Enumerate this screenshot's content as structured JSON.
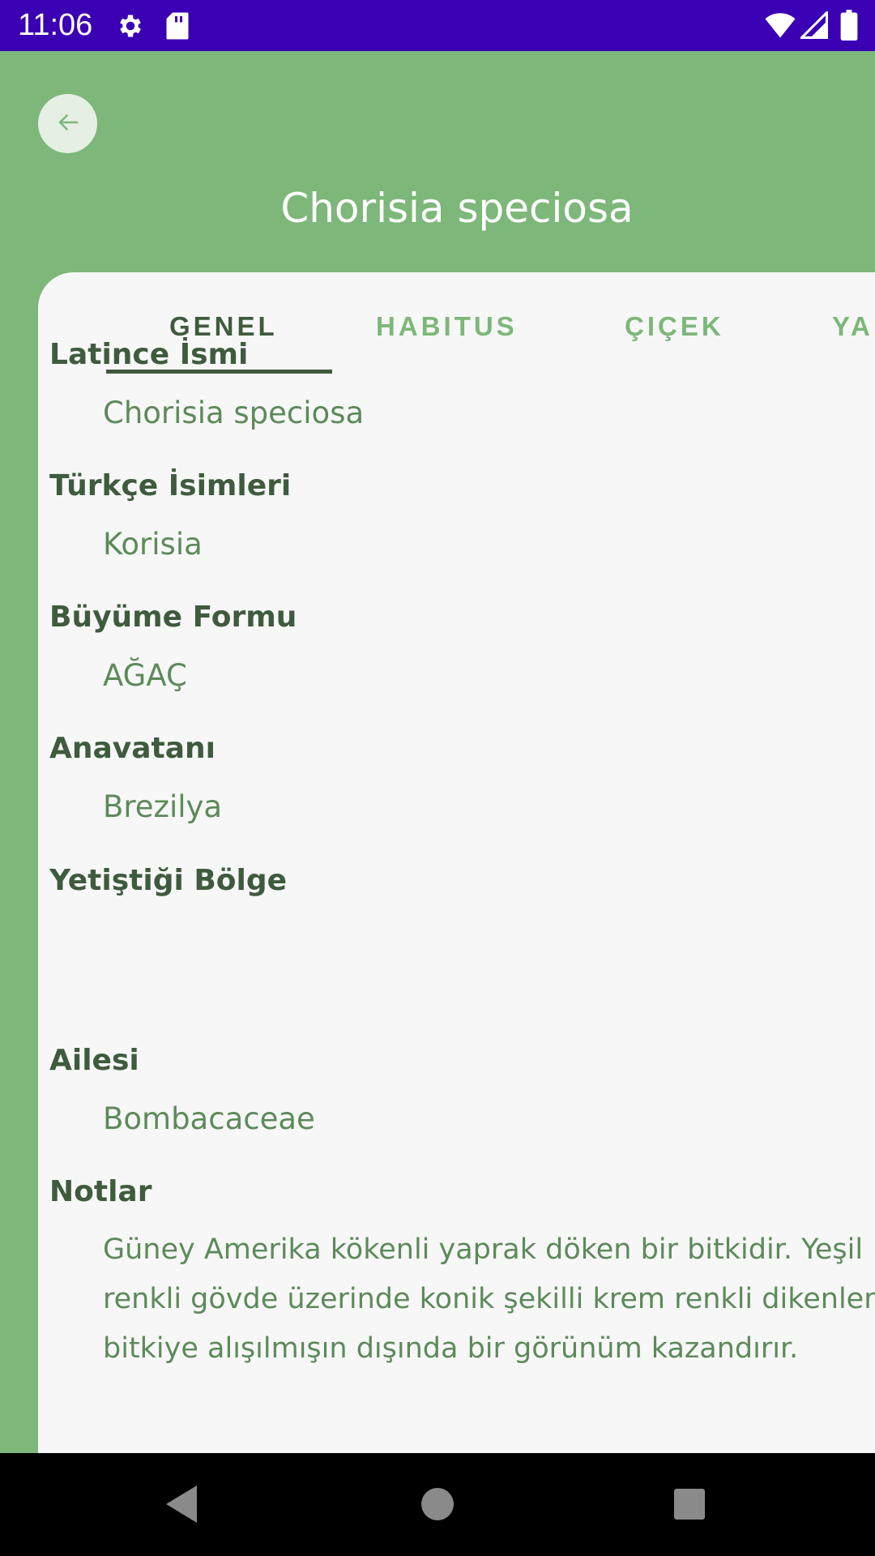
{
  "status_bar": {
    "time": "11:06",
    "icons": [
      "gear-icon",
      "sd-card-icon",
      "wifi-icon",
      "signal-icon",
      "battery-icon"
    ],
    "color": "#3b00b3"
  },
  "header": {
    "back_icon": "arrow-left-icon",
    "title": "Chorisia speciosa",
    "color": "#7db77a"
  },
  "tabs": [
    {
      "label": "GENEL",
      "active": true
    },
    {
      "label": "HABITUS",
      "active": false
    },
    {
      "label": "ÇIÇEK",
      "active": false
    },
    {
      "label": "YA",
      "active": false
    }
  ],
  "fields": [
    {
      "label": "Latince İsmi",
      "value": "Chorisia speciosa"
    },
    {
      "label": "Türkçe İsimleri",
      "value": "Korisia"
    },
    {
      "label": "Büyüme Formu",
      "value": "AĞAÇ"
    },
    {
      "label": "Anavatanı",
      "value": "Brezilya"
    },
    {
      "label": "Yetiştiği Bölge",
      "value": ""
    },
    {
      "label": "Ailesi",
      "value": "Bombacaceae"
    },
    {
      "label": "Notlar",
      "value": "Güney Amerika kökenli yaprak döken bir bitkidir. Yeşil renkli gövde üzerinde konik şekilli krem renkli dikenler bitkiye alışılmışın dışında bir görünüm kazandırır."
    }
  ],
  "colors": {
    "accent": "#7db77a",
    "label_dark": "#3f5b3d",
    "value_green": "#5d8a5a",
    "card_bg": "#f7f7f7"
  },
  "nav_bar": {
    "icons": [
      "nav-back-icon",
      "nav-home-icon",
      "nav-recents-icon"
    ]
  }
}
